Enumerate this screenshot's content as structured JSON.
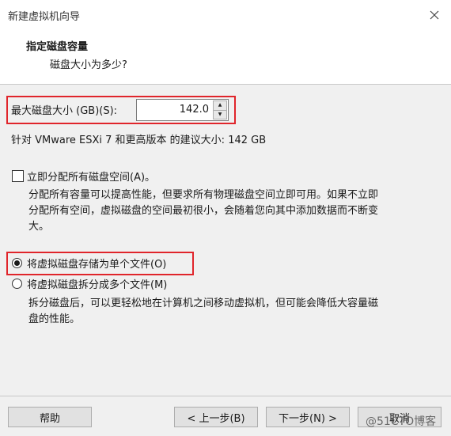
{
  "window": {
    "title": "新建虚拟机向导"
  },
  "header": {
    "title": "指定磁盘容量",
    "subtitle": "磁盘大小为多少?"
  },
  "disk": {
    "size_label": "最大磁盘大小 (GB)(S):",
    "size_value": "142.0",
    "recommendation": "针对 VMware ESXi 7 和更高版本 的建议大小: 142 GB"
  },
  "allocate": {
    "label": "立即分配所有磁盘空间(A)。",
    "checked": false,
    "desc_line1": "分配所有容量可以提高性能，但要求所有物理磁盘空间立即可用。如果不立即",
    "desc_line2": "分配所有空间，虚拟磁盘的空间最初很小，会随着您向其中添加数据而不断变",
    "desc_line3": "大。"
  },
  "storage_options": {
    "single_file_label": "将虚拟磁盘存储为单个文件(O)",
    "split_label": "将虚拟磁盘拆分成多个文件(M)",
    "split_desc_line1": "拆分磁盘后，可以更轻松地在计算机之间移动虚拟机，但可能会降低大容量磁",
    "split_desc_line2": "盘的性能。",
    "selected": "single"
  },
  "footer": {
    "help": "帮助",
    "back": "< 上一步(B)",
    "next": "下一步(N) >",
    "cancel": "取消"
  },
  "watermark": "@51CTO博客",
  "colors": {
    "highlight": "#e0252b",
    "background": "#f0f0f0"
  }
}
